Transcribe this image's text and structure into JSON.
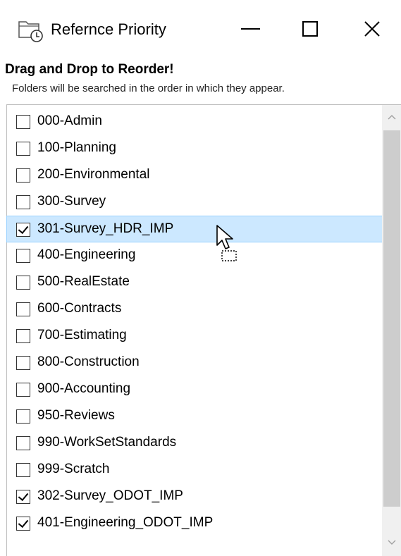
{
  "window": {
    "title": "Refernce Priority",
    "controls": {
      "minimize": "minimize",
      "maximize": "maximize",
      "close": "close"
    }
  },
  "header": {
    "heading": "Drag and Drop to Reorder!",
    "subheading": "Folders will be searched in the order in which they appear."
  },
  "folders": [
    {
      "label": "000-Admin",
      "checked": false
    },
    {
      "label": "100-Planning",
      "checked": false
    },
    {
      "label": "200-Environmental",
      "checked": false
    },
    {
      "label": "300-Survey",
      "checked": false
    },
    {
      "label": "301-Survey_HDR_IMP",
      "checked": true,
      "selected": true
    },
    {
      "label": "400-Engineering",
      "checked": false
    },
    {
      "label": "500-RealEstate",
      "checked": false
    },
    {
      "label": "600-Contracts",
      "checked": false
    },
    {
      "label": "700-Estimating",
      "checked": false
    },
    {
      "label": "800-Construction",
      "checked": false
    },
    {
      "label": "900-Accounting",
      "checked": false
    },
    {
      "label": "950-Reviews",
      "checked": false
    },
    {
      "label": "990-WorkSetStandards",
      "checked": false
    },
    {
      "label": "999-Scratch",
      "checked": false
    },
    {
      "label": "302-Survey_ODOT_IMP",
      "checked": true
    },
    {
      "label": "401-Engineering_ODOT_IMP",
      "checked": true
    }
  ],
  "icons": {
    "app": "folder-reference-icon",
    "cursor": "drag-cursor-icon"
  },
  "colors": {
    "selection_bg": "#cce8ff",
    "selection_border": "#99d1ff",
    "scroll_thumb": "#cdcdcd"
  }
}
